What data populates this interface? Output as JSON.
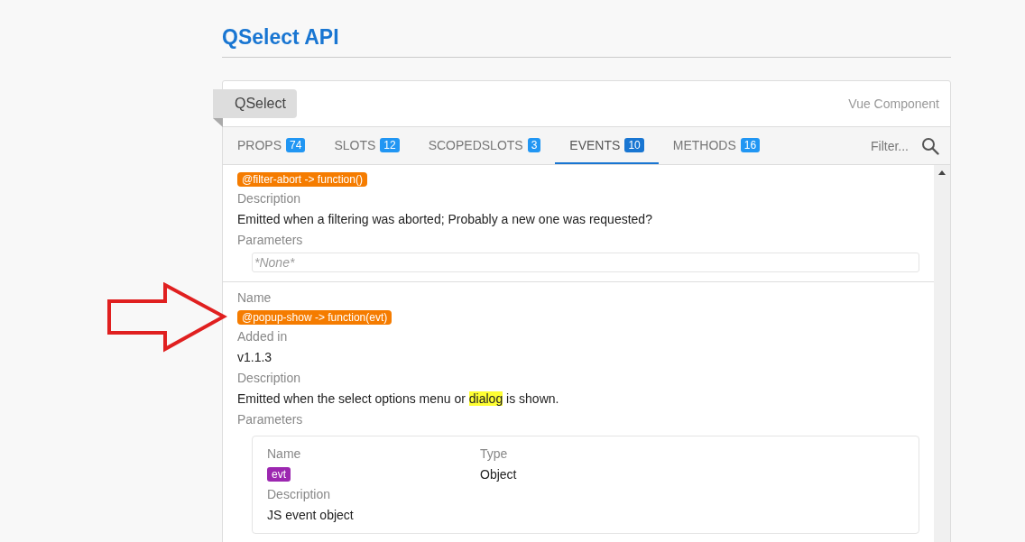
{
  "page_title": "QSelect API",
  "card": {
    "tag": "QSelect",
    "type_label": "Vue Component"
  },
  "tabs": [
    {
      "label": "PROPS",
      "count": "74",
      "selected": false
    },
    {
      "label": "SLOTS",
      "count": "12",
      "selected": false
    },
    {
      "label": "SCOPEDSLOTS",
      "count": "3",
      "selected": false
    },
    {
      "label": "EVENTS",
      "count": "10",
      "selected": true
    },
    {
      "label": "METHODS",
      "count": "16",
      "selected": false
    }
  ],
  "filter": {
    "placeholder": "Filter..."
  },
  "events": [
    {
      "entries": [
        {
          "kind": "badge",
          "text": "@filter-abort -> function()"
        },
        {
          "kind": "label",
          "text": "Description"
        },
        {
          "kind": "text",
          "parts": [
            {
              "text": "Emitted when a filtering was aborted; Probably a new one was requested?",
              "highlight": false
            }
          ]
        },
        {
          "kind": "label",
          "text": "Parameters"
        },
        {
          "kind": "empty",
          "text": "*None*"
        }
      ]
    },
    {
      "entries": [
        {
          "kind": "label",
          "text": "Name"
        },
        {
          "kind": "badge",
          "text": "@popup-show -> function(evt)"
        },
        {
          "kind": "label",
          "text": "Added in"
        },
        {
          "kind": "text",
          "parts": [
            {
              "text": "v1.1.3",
              "highlight": false
            }
          ]
        },
        {
          "kind": "label",
          "text": "Description"
        },
        {
          "kind": "text",
          "parts": [
            {
              "text": "Emitted when the select options menu or ",
              "highlight": false
            },
            {
              "text": "dialog",
              "highlight": true
            },
            {
              "text": " is shown.",
              "highlight": false
            }
          ]
        },
        {
          "kind": "label",
          "text": "Parameters"
        },
        {
          "kind": "params",
          "params": [
            {
              "name_label": "Name",
              "name": "evt",
              "type_label": "Type",
              "type": "Object",
              "description_label": "Description",
              "description": "JS event object"
            }
          ]
        }
      ]
    }
  ]
}
